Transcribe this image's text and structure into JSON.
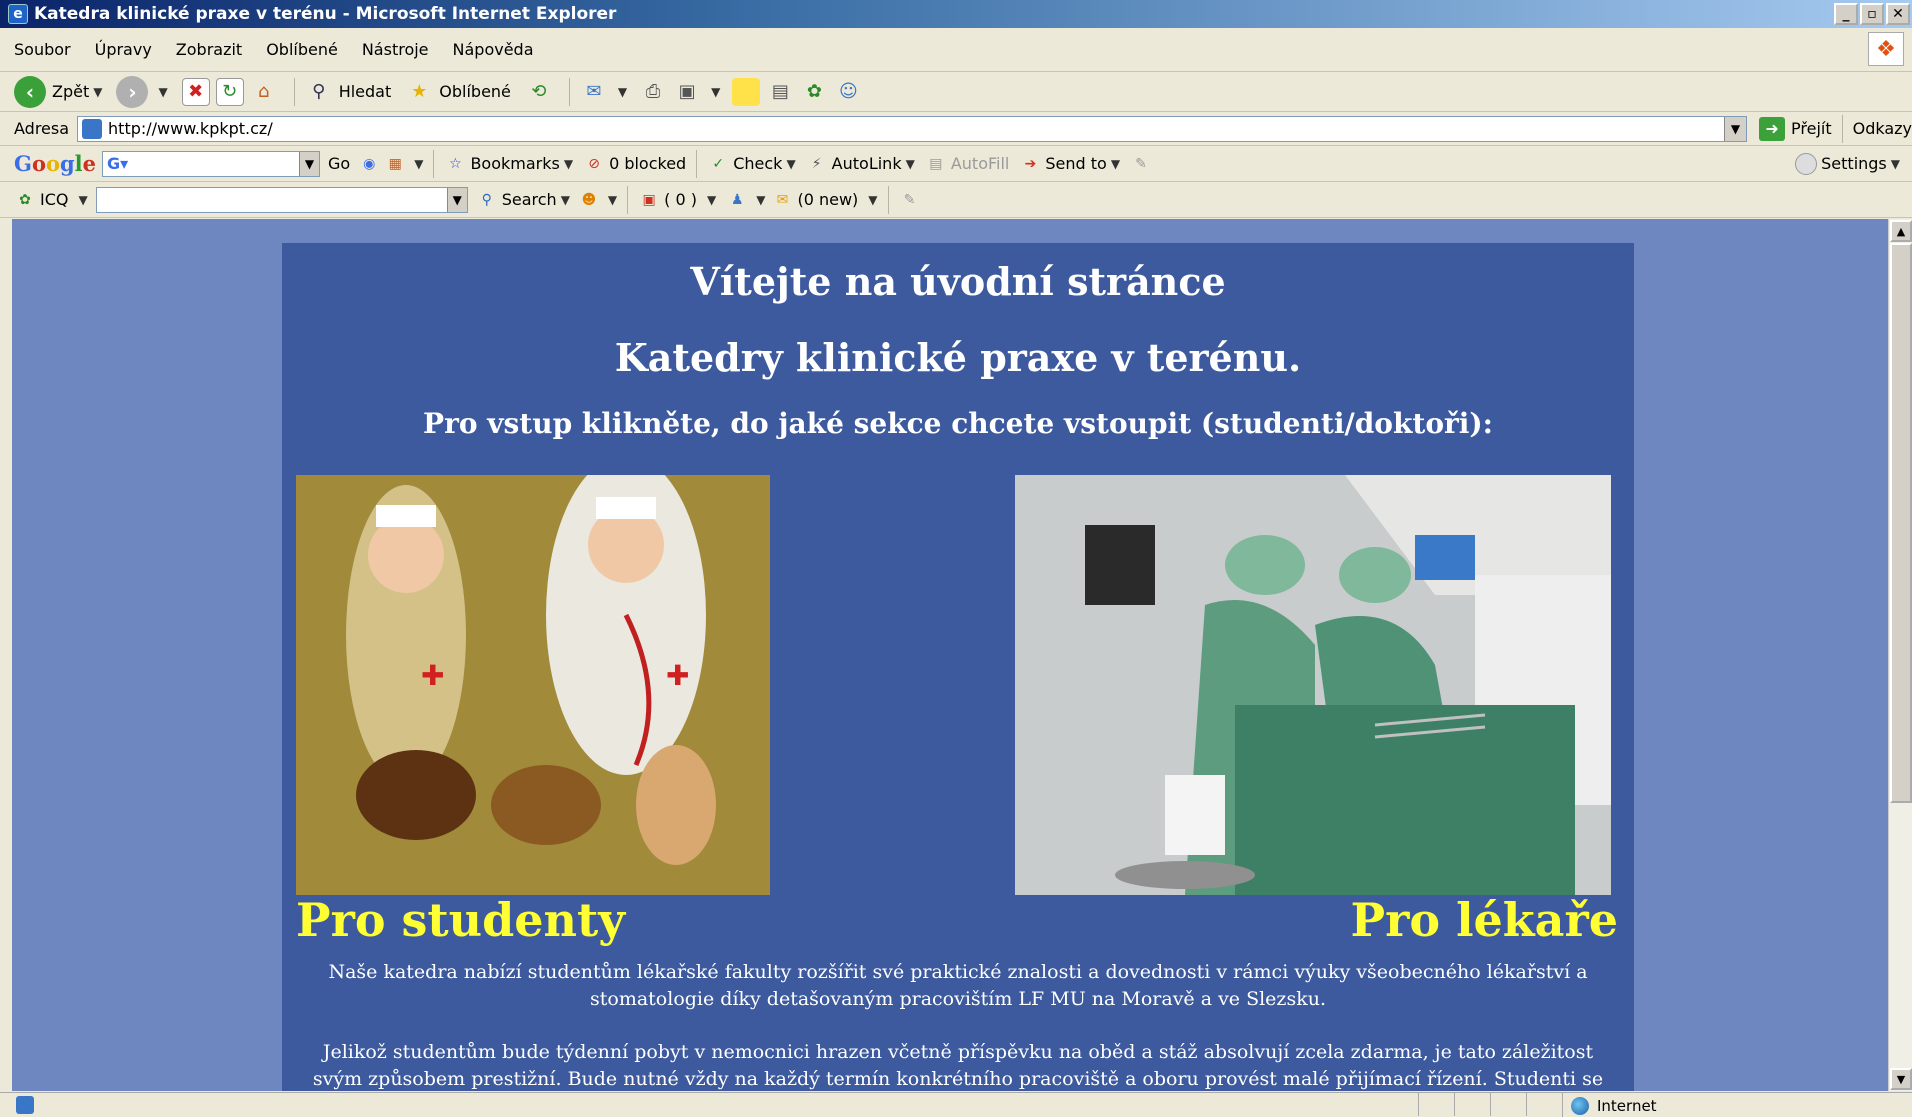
{
  "window": {
    "title": "Katedra klinické praxe v terénu - Microsoft Internet Explorer"
  },
  "menu": {
    "items": [
      "Soubor",
      "Úpravy",
      "Zobrazit",
      "Oblíbené",
      "Nástroje",
      "Nápověda"
    ]
  },
  "toolbar": {
    "back_label": "Zpět",
    "search_label": "Hledat",
    "favorites_label": "Oblíbené"
  },
  "address": {
    "label": "Adresa",
    "url": "http://www.kpkpt.cz/",
    "go_label": "Přejít",
    "links_label": "Odkazy"
  },
  "google_toolbar": {
    "logo": "Google",
    "go_label": "Go",
    "bookmarks_label": "Bookmarks",
    "blocked_label": "0 blocked",
    "check_label": "Check",
    "autolink_label": "AutoLink",
    "autofill_label": "AutoFill",
    "sendto_label": "Send to",
    "settings_label": "Settings"
  },
  "icq_toolbar": {
    "label": "ICQ",
    "search_label": "Search",
    "count_label": "( 0 )",
    "mail_label": "(0 new)"
  },
  "page": {
    "welcome_title": "Vítejte na úvodní stránce",
    "dept_title": "Katedry klinické praxe v terénu.",
    "instruction": "Pro vstup klikněte, do jaké sekce chcete vstoupit (studenti/doktoři):",
    "students_link": "Pro studenty",
    "doctors_link": "Pro lékaře",
    "paragraph1": "Naše katedra nabízí studentům lékařské fakulty rozšířit své praktické znalosti a dovednosti v rámci výuky všeobecného lékařství a stomatologie díky detašovaným pracovištím LF MU na Moravě a ve Slezsku.",
    "paragraph2": "Jelikož studentům bude týdenní pobyt v nemocnici hrazen včetně příspěvku na oběd a stáž absolvují zcela zdarma, je tato záležitost svým způsobem prestižní. Bude nutné vždy na každý termín konkrétního pracoviště a oboru provést malé přijímací řízení. Studenti se do něj přestěhovat tohoto portálu přihlásí a před začátkem každého semestru budou vybráni dva studenti, což bude sloužit..."
  },
  "status": {
    "zone_label": "Internet"
  },
  "colors": {
    "page_bg": "#6e87c0",
    "panel_bg": "#3d5a9e",
    "link_yellow": "#ffff33"
  }
}
